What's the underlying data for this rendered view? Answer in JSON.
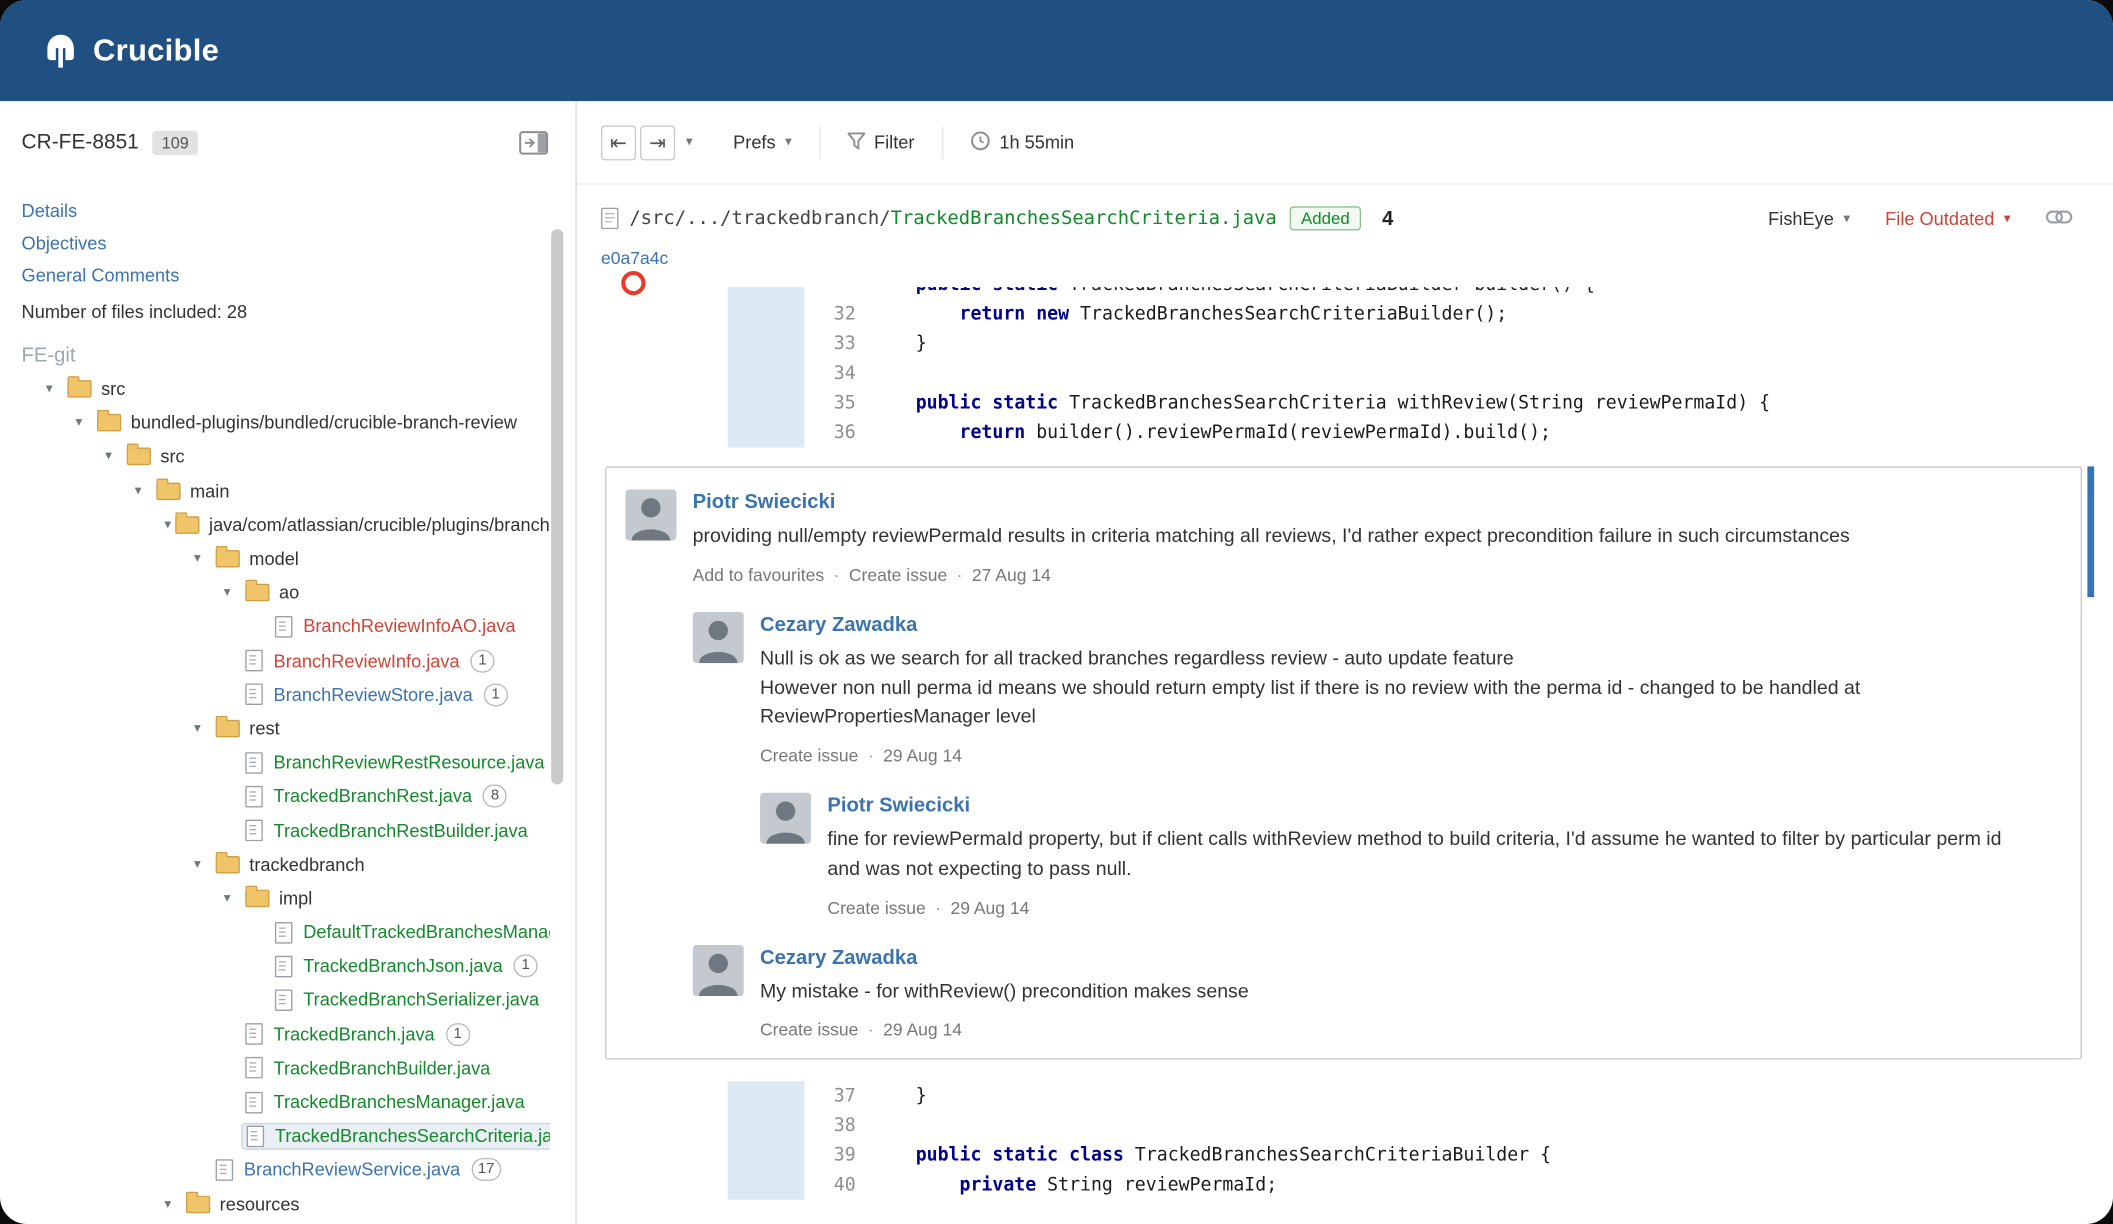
{
  "colors": {
    "header": "#205081",
    "link": "#3b73af",
    "added_green": "#14892c",
    "deleted_red": "#d04437",
    "modified_blue": "#3b73af",
    "keyword": "#00008b",
    "gutter_added": "#dbe9f2",
    "unread_indicator": "#3573b1",
    "outdated_red": "#d04437",
    "avatar_bg": "#c3c9cf"
  },
  "icons": {
    "logo": "crucible-helmet-icon",
    "expanded_glyph": "▾",
    "caret_glyph": "▾",
    "prev_glyph": "⇤",
    "next_glyph": "⇥",
    "separator": "·"
  },
  "navbar": {
    "brand": "Crucible"
  },
  "sidebar": {
    "review_id": "CR-FE-8851",
    "review_count": "109",
    "links": [
      "Details",
      "Objectives",
      "General Comments"
    ],
    "files_note": "Number of files included: 28",
    "repo": "FE-git",
    "tree": [
      {
        "depth": 0,
        "type": "folder",
        "label": "src"
      },
      {
        "depth": 1,
        "type": "folder",
        "label": "bundled-plugins/bundled/crucible-branch-review"
      },
      {
        "depth": 2,
        "type": "folder",
        "label": "src"
      },
      {
        "depth": 3,
        "type": "folder",
        "label": "main"
      },
      {
        "depth": 4,
        "type": "folder",
        "label": "java/com/atlassian/crucible/plugins/branch"
      },
      {
        "depth": 5,
        "type": "folder",
        "label": "model"
      },
      {
        "depth": 6,
        "type": "folder",
        "label": "ao"
      },
      {
        "depth": 7,
        "type": "file",
        "label": "BranchReviewInfoAO.java",
        "color": "red"
      },
      {
        "depth": 6,
        "type": "file",
        "label": "BranchReviewInfo.java",
        "color": "red",
        "badge": "1"
      },
      {
        "depth": 6,
        "type": "file",
        "label": "BranchReviewStore.java",
        "color": "blue",
        "badge": "1"
      },
      {
        "depth": 5,
        "type": "folder",
        "label": "rest"
      },
      {
        "depth": 6,
        "type": "file",
        "label": "BranchReviewRestResource.java",
        "color": "green"
      },
      {
        "depth": 6,
        "type": "file",
        "label": "TrackedBranchRest.java",
        "color": "green",
        "badge": "8"
      },
      {
        "depth": 6,
        "type": "file",
        "label": "TrackedBranchRestBuilder.java",
        "color": "green"
      },
      {
        "depth": 5,
        "type": "folder",
        "label": "trackedbranch"
      },
      {
        "depth": 6,
        "type": "folder",
        "label": "impl"
      },
      {
        "depth": 7,
        "type": "file",
        "label": "DefaultTrackedBranchesManager.java",
        "color": "green"
      },
      {
        "depth": 7,
        "type": "file",
        "label": "TrackedBranchJson.java",
        "color": "green",
        "badge": "1"
      },
      {
        "depth": 7,
        "type": "file",
        "label": "TrackedBranchSerializer.java",
        "color": "green"
      },
      {
        "depth": 6,
        "type": "file",
        "label": "TrackedBranch.java",
        "color": "green",
        "badge": "1"
      },
      {
        "depth": 6,
        "type": "file",
        "label": "TrackedBranchBuilder.java",
        "color": "green"
      },
      {
        "depth": 6,
        "type": "file",
        "label": "TrackedBranchesManager.java",
        "color": "green"
      },
      {
        "depth": 6,
        "type": "file",
        "label": "TrackedBranchesSearchCriteria.java",
        "color": "green",
        "selected": true
      },
      {
        "depth": 5,
        "type": "file",
        "label": "BranchReviewService.java",
        "color": "blue",
        "badge": "17"
      },
      {
        "depth": 4,
        "type": "folder",
        "label": "resources"
      }
    ]
  },
  "toolbar": {
    "prefs": "Prefs",
    "filter": "Filter",
    "time": "1h 55min"
  },
  "file_header": {
    "path_prefix": "/src/.../trackedbranch/",
    "path_file": "TrackedBranchesSearchCriteria.java",
    "status": "Added",
    "comment_count": "4",
    "fisheye": "FishEye",
    "outdated": "File Outdated",
    "revision": "e0a7a4c"
  },
  "diff": {
    "block1": {
      "clipped_top": {
        "seg": [
          {
            "t": "    "
          },
          {
            "t": "public",
            "k": true
          },
          {
            "t": " "
          },
          {
            "t": "static",
            "k": true
          },
          {
            "t": " TrackedBranchesSearchCriteriaBuilder builder() {"
          }
        ]
      },
      "lines": [
        {
          "no": "32",
          "seg": [
            {
              "t": "        "
            },
            {
              "t": "return",
              "k": true
            },
            {
              "t": " "
            },
            {
              "t": "new",
              "k": true
            },
            {
              "t": " TrackedBranchesSearchCriteriaBuilder();"
            }
          ]
        },
        {
          "no": "33",
          "seg": [
            {
              "t": "    }"
            }
          ]
        },
        {
          "no": "34",
          "seg": []
        },
        {
          "no": "35",
          "seg": [
            {
              "t": "    "
            },
            {
              "t": "public",
              "k": true
            },
            {
              "t": " "
            },
            {
              "t": "static",
              "k": true
            },
            {
              "t": " TrackedBranchesSearchCriteria withReview(String reviewPermaId) {"
            }
          ]
        },
        {
          "no": "36",
          "seg": [
            {
              "t": "        "
            },
            {
              "t": "return",
              "k": true
            },
            {
              "t": " builder().reviewPermaId(reviewPermaId).build();"
            }
          ]
        }
      ]
    },
    "block2": {
      "lines": [
        {
          "no": "37",
          "seg": [
            {
              "t": "    }"
            }
          ]
        },
        {
          "no": "38",
          "seg": []
        },
        {
          "no": "39",
          "seg": [
            {
              "t": "    "
            },
            {
              "t": "public",
              "k": true
            },
            {
              "t": " "
            },
            {
              "t": "static",
              "k": true
            },
            {
              "t": " "
            },
            {
              "t": "class",
              "k": true
            },
            {
              "t": " TrackedBranchesSearchCriteriaBuilder {"
            }
          ]
        },
        {
          "no": "40",
          "seg": [
            {
              "t": "        "
            },
            {
              "t": "private",
              "k": true
            },
            {
              "t": " String reviewPermaId;"
            }
          ]
        }
      ]
    }
  },
  "comments": [
    {
      "author": "Piotr Swiecicki",
      "text": [
        "providing null/empty reviewPermaId results in criteria matching all reviews, I'd rather expect precondition failure in such circumstances"
      ],
      "actions": [
        "Add to favourites",
        "Create issue"
      ],
      "date": "27 Aug 14",
      "unread_bar": true,
      "replies": [
        {
          "author": "Cezary Zawadka",
          "text": [
            "Null is ok as we search for all tracked branches regardless review - auto update feature",
            "However non null perma id means we should return empty list if there is no review with the perma id - changed to be handled at",
            "ReviewPropertiesManager level"
          ],
          "actions": [
            "Create issue"
          ],
          "date": "29 Aug 14",
          "replies": [
            {
              "author": "Piotr Swiecicki",
              "text": [
                "fine for reviewPermaId property, but if client calls withReview method to build criteria, I'd assume he wanted to filter by particular perm id",
                "and was not expecting to pass null."
              ],
              "actions": [
                "Create issue"
              ],
              "date": "29 Aug 14",
              "replies": []
            }
          ]
        },
        {
          "author": "Cezary Zawadka",
          "text": [
            "My mistake - for withReview() precondition makes sense"
          ],
          "actions": [
            "Create issue"
          ],
          "date": "29 Aug 14",
          "replies": []
        }
      ]
    }
  ]
}
